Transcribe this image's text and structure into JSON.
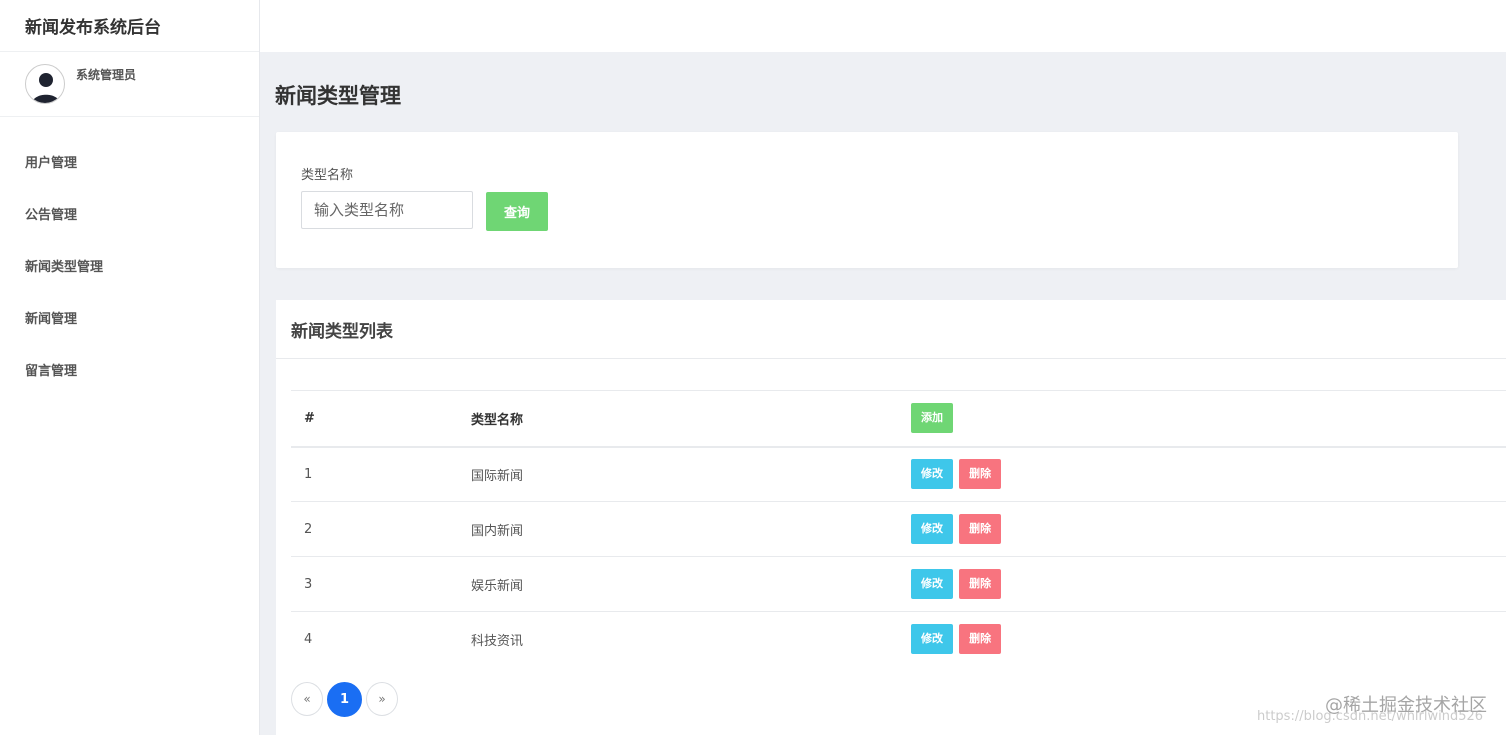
{
  "app": {
    "title": "新闻发布系统后台"
  },
  "user": {
    "name": "系统管理员"
  },
  "sidebar": {
    "items": [
      {
        "label": "用户管理"
      },
      {
        "label": "公告管理"
      },
      {
        "label": "新闻类型管理"
      },
      {
        "label": "新闻管理"
      },
      {
        "label": "留言管理"
      }
    ]
  },
  "page": {
    "title": "新闻类型管理"
  },
  "search": {
    "label": "类型名称",
    "placeholder": "输入类型名称",
    "value": "",
    "button_label": "查询"
  },
  "list": {
    "title": "新闻类型列表",
    "columns": {
      "index": "#",
      "name": "类型名称"
    },
    "add_label": "添加",
    "edit_label": "修改",
    "delete_label": "删除",
    "rows": [
      {
        "index": "1",
        "name": "国际新闻"
      },
      {
        "index": "2",
        "name": "国内新闻"
      },
      {
        "index": "3",
        "name": "娱乐新闻"
      },
      {
        "index": "4",
        "name": "科技资讯"
      }
    ]
  },
  "pagination": {
    "prev": "«",
    "current": "1",
    "next": "»"
  },
  "watermark": {
    "line1": "@稀土掘金技术社区",
    "line2": "https://blog.csdn.net/whirlwind526"
  },
  "colors": {
    "primary": "#1a6ef3",
    "success": "#6fd674",
    "info": "#3ec7ea",
    "danger": "#f8747f"
  }
}
